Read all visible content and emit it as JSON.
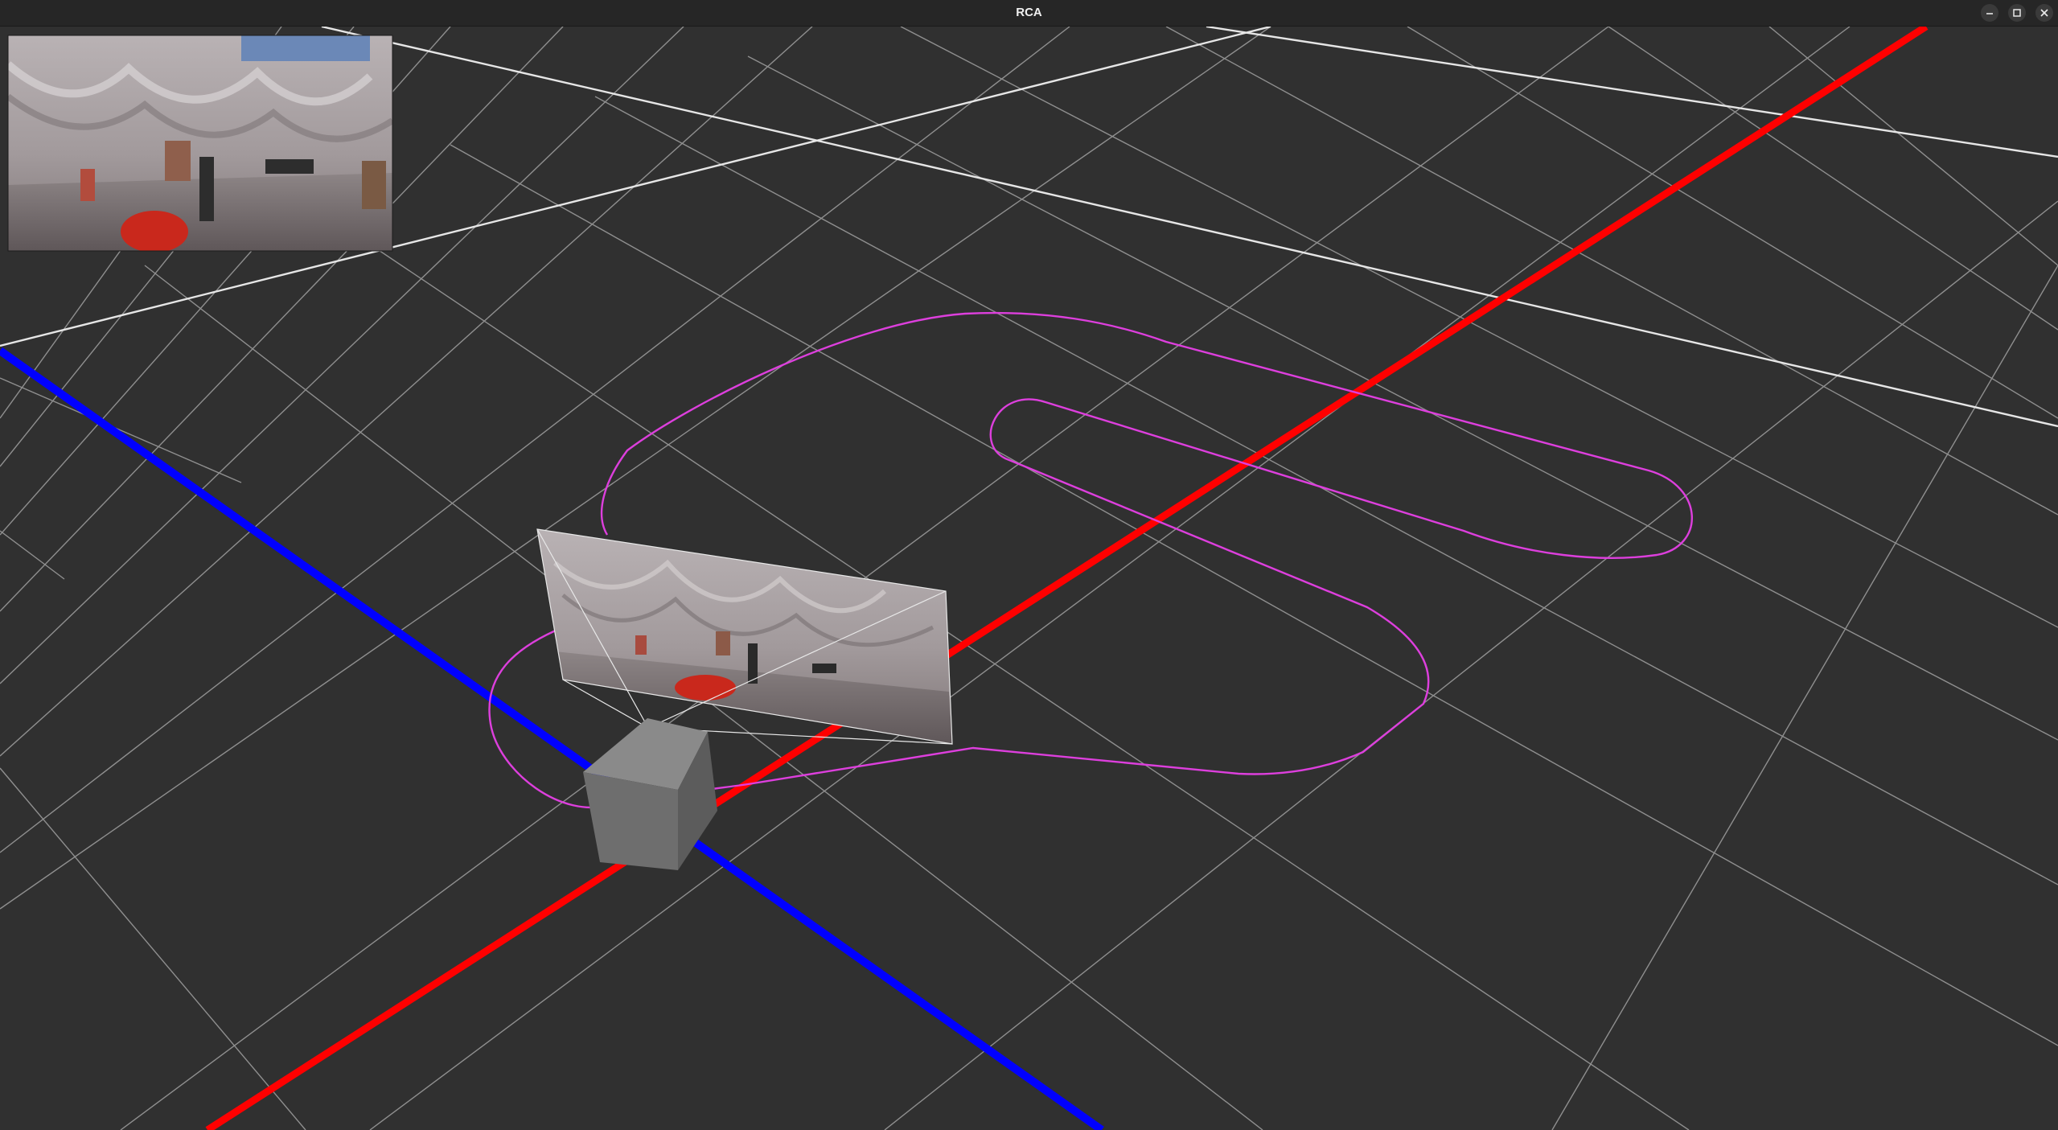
{
  "window": {
    "title": "RCA",
    "controls": [
      "minimize-icon",
      "maximize-icon",
      "close-icon"
    ]
  },
  "scene": {
    "axes": {
      "x_axis_color": "#ff0000",
      "y_axis_color": "#0000ff"
    },
    "grid_color": "#8a8a8a",
    "background_color": "#303030",
    "path_color": "#e040e0",
    "robot_body_color": "#7a7a7a"
  },
  "image_panel": {
    "content": "camera-feed-image"
  },
  "camera_frustum": {
    "content": "projected-camera-image"
  }
}
